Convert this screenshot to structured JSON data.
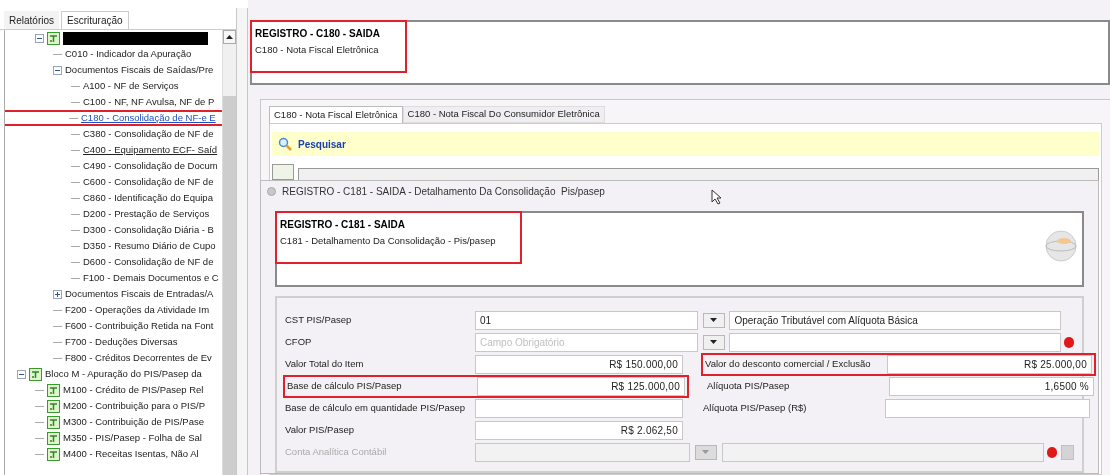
{
  "left_tabs": [
    {
      "label": "Relatórios",
      "selected": false
    },
    {
      "label": "Escrituração",
      "selected": true
    }
  ],
  "tree": [
    {
      "kind": "redacted",
      "icon": true,
      "expanded": true,
      "selected": false,
      "underlined": false,
      "children": [
        {
          "label": "C010 - Indicador da Apuração",
          "selected": false,
          "underlined": false
        },
        {
          "label": "Documentos Fiscais de Saídas/Pre",
          "expanded": true,
          "selected": false,
          "underlined": false,
          "children": [
            {
              "label": "A100 - NF de Serviços",
              "selected": false,
              "underlined": false
            },
            {
              "label": "C100 - NF, NF Avulsa, NF de P",
              "selected": false,
              "underlined": false
            },
            {
              "label": "C180 - Consolidação de NF-e E",
              "selected": true,
              "underlined": true
            },
            {
              "label": "C380 - Consolidação de NF de",
              "selected": false,
              "underlined": false
            },
            {
              "label": "C400 - Equipamento ECF- Saíd",
              "selected": false,
              "underlined": true
            },
            {
              "label": "C490 - Consolidação de Docum",
              "selected": false,
              "underlined": false
            },
            {
              "label": "C600 - Consolidação de NF de",
              "selected": false,
              "underlined": false
            },
            {
              "label": "C860 - Identificação do Equipa",
              "selected": false,
              "underlined": false
            },
            {
              "label": "D200 - Prestação de Serviços",
              "selected": false,
              "underlined": false
            },
            {
              "label": "D300 - Consolidação Diária - B",
              "selected": false,
              "underlined": false
            },
            {
              "label": "D350 - Resumo Diário de Cupo",
              "selected": false,
              "underlined": false
            },
            {
              "label": "D600 - Consolidação de NF de",
              "selected": false,
              "underlined": false
            },
            {
              "label": "F100 - Demais Documentos e C",
              "selected": false,
              "underlined": false
            }
          ]
        },
        {
          "label": "Documentos Fiscais de Entradas/A",
          "expanded": false,
          "selected": false,
          "underlined": false
        },
        {
          "label": "F200 - Operações da Atividade Im",
          "selected": false,
          "underlined": false
        },
        {
          "label": "F600 - Contribuição Retida na Font",
          "selected": false,
          "underlined": false
        },
        {
          "label": "F700 - Deduções Diversas",
          "selected": false,
          "underlined": false
        },
        {
          "label": "F800 - Créditos Decorrentes de Ev",
          "selected": false,
          "underlined": false
        }
      ]
    },
    {
      "label": "Bloco M - Apuração do PIS/Pasep da",
      "icon": true,
      "expanded": true,
      "selected": false,
      "underlined": false,
      "children": [
        {
          "label": "M100 - Crédito de PIS/Pasep Rel",
          "icon": true,
          "selected": false,
          "underlined": false
        },
        {
          "label": "M200 - Contribuição para o PIS/P",
          "icon": true,
          "selected": false,
          "underlined": false
        },
        {
          "label": "M300 - Contribuição de PIS/Pase",
          "icon": true,
          "selected": false,
          "underlined": false
        },
        {
          "label": "M350 - PIS/Pasep - Folha de Sal",
          "icon": true,
          "selected": false,
          "underlined": false
        },
        {
          "label": "M400 - Receitas Isentas, Não Al",
          "icon": true,
          "selected": false,
          "underlined": false
        }
      ]
    }
  ],
  "header": {
    "title": "REGISTRO - C180 - SAIDA",
    "subtitle": "C180 - Nota Fiscal Eletrônica"
  },
  "tabs": [
    {
      "label": "C180 - Nota Fiscal Eletrônica",
      "selected": true
    },
    {
      "label": "C180 - Nota Fiscal Do Consumidor Eletrônica",
      "selected": false
    }
  ],
  "search_button": "Pesquisar",
  "dialog": {
    "title": "REGISTRO - C181 - SAIDA - Detalhamento Da Consolidação  Pis/pasep",
    "header": {
      "title": "REGISTRO - C181 - SAIDA",
      "subtitle": "C181 - Detalhamento Da Consolidação - Pis/pasep"
    },
    "rows": [
      {
        "kind": "select",
        "label": "CST PIS/Pasep",
        "value": "01",
        "description": "Operação Tributável com Alíquota Básica",
        "required": false,
        "disabled": false
      },
      {
        "kind": "select",
        "label": "CFOP",
        "placeholder": "Campo Obrigatório",
        "required": true,
        "disabled": false
      },
      {
        "kind": "pair",
        "left": {
          "label": "Valor Total do Item",
          "value": "R$ 150.000,00",
          "highlighted": false
        },
        "right": {
          "label": "Valor do desconto comercial / Exclusão",
          "value": "R$ 25.000,00",
          "highlighted": true
        }
      },
      {
        "kind": "pair",
        "left": {
          "label": "Base de cálculo PIS/Pasep",
          "value": "R$ 125.000,00",
          "highlighted": true
        },
        "right": {
          "label": "Alíquota PIS/Pasep",
          "value": "1,6500 %",
          "highlighted": false
        }
      },
      {
        "kind": "pair",
        "left": {
          "label": "Base de cálculo em quantidade PIS/Pasep",
          "highlighted": false
        },
        "right": {
          "label": "Alíquota PIS/Pasep (R$)",
          "highlighted": false
        }
      },
      {
        "kind": "pair",
        "left": {
          "label": "Valor PIS/Pasep",
          "value": "R$ 2.062,50",
          "highlighted": false
        }
      },
      {
        "kind": "select",
        "label": "Conta Analítica Contábil",
        "required": true,
        "disabled": true,
        "extra_button": true
      }
    ]
  }
}
